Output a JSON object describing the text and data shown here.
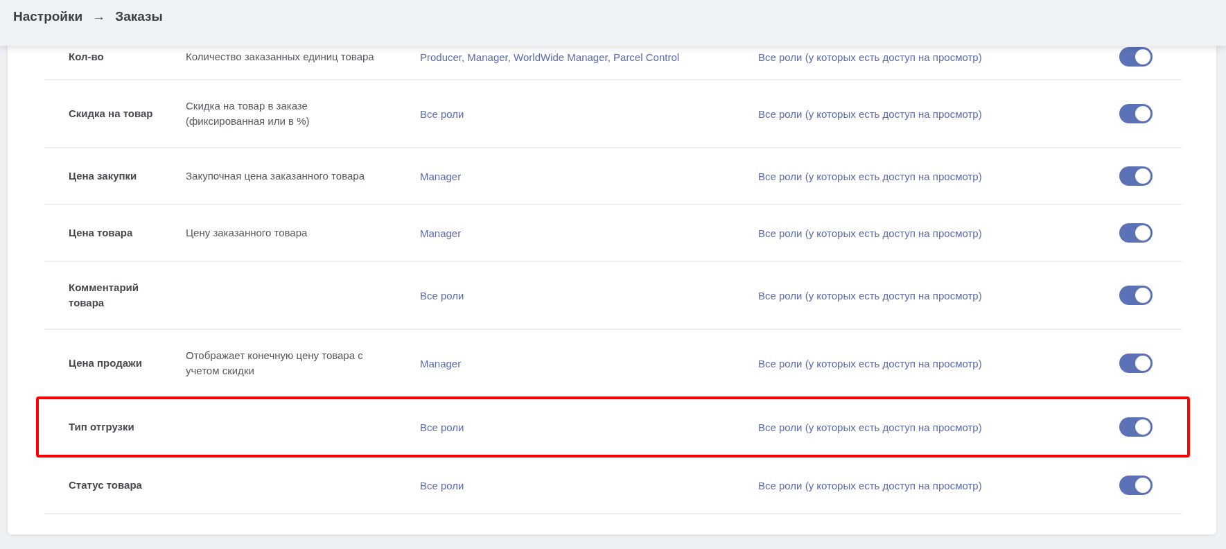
{
  "breadcrumb": {
    "parent": "Настройки",
    "separator": "→",
    "current": "Заказы"
  },
  "rows": [
    {
      "name": "Кол-во",
      "description": "Количество заказанных единиц товара",
      "edit_roles": "Producer, Manager, WorldWide Manager, Parcel Control",
      "view_roles": "Все роли (у которых есть доступ на просмотр)",
      "on": true,
      "highlighted": false
    },
    {
      "name": "Скидка на товар",
      "description": "Скидка на товар в заказе (фиксированная или в %)",
      "edit_roles": "Все роли",
      "view_roles": "Все роли (у которых есть доступ на просмотр)",
      "on": true,
      "highlighted": false
    },
    {
      "name": "Цена закупки",
      "description": "Закупочная цена заказанного товара",
      "edit_roles": "Manager",
      "view_roles": "Все роли (у которых есть доступ на просмотр)",
      "on": true,
      "highlighted": false
    },
    {
      "name": "Цена товара",
      "description": "Цену заказанного товара",
      "edit_roles": "Manager",
      "view_roles": "Все роли (у которых есть доступ на просмотр)",
      "on": true,
      "highlighted": false
    },
    {
      "name": "Комментарий товара",
      "edit_roles": "Все роли",
      "view_roles": "Все роли (у которых есть доступ на просмотр)",
      "on": true,
      "highlighted": false
    },
    {
      "name": "Цена продажи",
      "description": "Отображает конечную цену товара с учетом скидки",
      "edit_roles": "Manager",
      "view_roles": "Все роли (у которых есть доступ на просмотр)",
      "on": true,
      "highlighted": false
    },
    {
      "name": "Тип отгрузки",
      "edit_roles": "Все роли",
      "view_roles": "Все роли (у которых есть доступ на просмотр)",
      "on": true,
      "highlighted": true
    },
    {
      "name": "Статус товара",
      "edit_roles": "Все роли",
      "view_roles": "Все роли (у которых есть доступ на просмотр)",
      "on": true,
      "highlighted": false
    }
  ]
}
